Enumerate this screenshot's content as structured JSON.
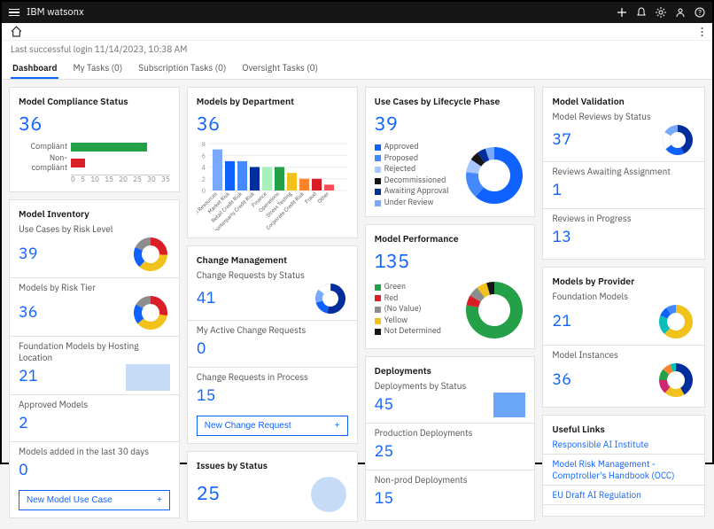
{
  "header": {
    "app_name": "IBM watsonx"
  },
  "last_login": "Last successful login 11/14/2023, 10:38 AM",
  "tabs": [
    {
      "label": "Dashboard",
      "active": true
    },
    {
      "label": "My Tasks (0)"
    },
    {
      "label": "Subscription Tasks (0)"
    },
    {
      "label": "Oversight Tasks (0)"
    }
  ],
  "compliance": {
    "title": "Model Compliance Status",
    "value": "36",
    "rows": [
      {
        "label": "Compliant",
        "value": 27,
        "color": "#24a148"
      },
      {
        "label": "Non-compliant",
        "value": 5,
        "color": "#da1e28"
      }
    ],
    "axis": [
      "0",
      "5",
      "10",
      "15",
      "20",
      "25",
      "30",
      "35"
    ]
  },
  "inventory": {
    "title": "Model Inventory",
    "items": [
      {
        "label": "Use Cases by Risk Level",
        "value": "39",
        "chart": "donut1"
      },
      {
        "label": "Models by Risk Tier",
        "value": "36",
        "chart": "donut2"
      },
      {
        "label": "Foundation Models by Hosting Location",
        "value": "21",
        "chart": "placeholder"
      },
      {
        "label": "Approved Models",
        "value": "2"
      },
      {
        "label": "Models added in the last 30 days",
        "value": "0"
      }
    ],
    "button": "New Model Use Case"
  },
  "dept": {
    "title": "Models by Department",
    "value": "36",
    "bars": [
      {
        "label": "Human Resources",
        "v": 7,
        "c": "#78a9ff"
      },
      {
        "label": "Market Risk",
        "v": 5,
        "c": "#0f62fe"
      },
      {
        "label": "Retail Credit Risk",
        "v": 5,
        "c": "#4589ff"
      },
      {
        "label": "Counterparty Credit Risk",
        "v": 4,
        "c": "#002d9c"
      },
      {
        "label": "Finance",
        "v": 4,
        "c": "#a7f0ba"
      },
      {
        "label": "Operations",
        "v": 4,
        "c": "#24a148"
      },
      {
        "label": "Stress Testing",
        "v": 3,
        "c": "#f1c21b"
      },
      {
        "label": "Corporate Credit Risk",
        "v": 2,
        "c": "#ff832b"
      },
      {
        "label": "Fraud",
        "v": 2,
        "c": "#da1e28"
      },
      {
        "label": "Other",
        "v": 1,
        "c": "#fa4d56"
      }
    ]
  },
  "change": {
    "title": "Change Management",
    "items": [
      {
        "label": "Change Requests by Status",
        "value": "41",
        "chart": "donut3"
      },
      {
        "label": "My Active Change Requests",
        "value": "0"
      },
      {
        "label": "Change Requests in Process",
        "value": "15"
      }
    ],
    "button": "New Change Request"
  },
  "issues": {
    "title": "Issues by Status",
    "value": "25"
  },
  "lifecycle": {
    "title": "Use Cases by Lifecycle Phase",
    "value": "39",
    "legend": [
      {
        "label": "Approved",
        "c": "#0f62fe"
      },
      {
        "label": "Proposed",
        "c": "#4589ff"
      },
      {
        "label": "Rejected",
        "c": "#a6c8ff"
      },
      {
        "label": "Decommissioned",
        "c": "#161616"
      },
      {
        "label": "Awaiting Approval",
        "c": "#002d9c"
      },
      {
        "label": "Under Review",
        "c": "#78a9ff"
      }
    ]
  },
  "perf": {
    "title": "Model Performance",
    "value": "135",
    "legend": [
      {
        "label": "Green",
        "c": "#24a148"
      },
      {
        "label": "Red",
        "c": "#da1e28"
      },
      {
        "label": "(No Value)",
        "c": "#8d8d8d"
      },
      {
        "label": "Yellow",
        "c": "#f1c21b"
      },
      {
        "label": "Not Determined",
        "c": "#161616"
      }
    ]
  },
  "deploy": {
    "title": "Deployments",
    "items": [
      {
        "label": "Deployments by Status",
        "value": "45",
        "chart": "bar"
      },
      {
        "label": "Production Deployments",
        "value": "25"
      },
      {
        "label": "Non-prod Deployments",
        "value": "15"
      }
    ]
  },
  "validation": {
    "title": "Model Validation",
    "items": [
      {
        "label": "Model Reviews by Status",
        "value": "37",
        "chart": "donut4"
      },
      {
        "label": "Reviews Awaiting Assignment",
        "value": "1"
      },
      {
        "label": "Reviews in Progress",
        "value": "13"
      }
    ]
  },
  "provider": {
    "title": "Models by Provider",
    "items": [
      {
        "label": "Foundation Models",
        "value": "21",
        "chart": "donut5"
      },
      {
        "label": "Model Instances",
        "value": "36",
        "chart": "donut6"
      }
    ]
  },
  "links": {
    "title": "Useful Links",
    "items": [
      "Responsible AI Institute",
      "Model Risk Management - Comptroller's Handbook (OCC)",
      "EU Draft AI Regulation"
    ]
  },
  "chart_data": [
    {
      "id": "compliance",
      "type": "bar",
      "orientation": "horizontal",
      "categories": [
        "Compliant",
        "Non-compliant"
      ],
      "values": [
        27,
        5
      ],
      "xlim": [
        0,
        35
      ]
    },
    {
      "id": "models_by_department",
      "type": "bar",
      "categories": [
        "Human Resources",
        "Market Risk",
        "Retail Credit Risk",
        "Counterparty Credit Risk",
        "Finance",
        "Operations",
        "Stress Testing",
        "Corporate Credit Risk",
        "Fraud",
        "Other"
      ],
      "values": [
        7,
        5,
        5,
        4,
        4,
        4,
        3,
        2,
        2,
        1
      ],
      "ylim": [
        0,
        8
      ]
    },
    {
      "id": "use_cases_by_risk_level",
      "type": "donut",
      "total": 39,
      "series": [
        {
          "name": "red",
          "value": 10,
          "color": "#da1e28"
        },
        {
          "name": "yellow",
          "value": 14,
          "color": "#f1c21b"
        },
        {
          "name": "blue",
          "value": 8,
          "color": "#0f62fe"
        },
        {
          "name": "grey",
          "value": 7,
          "color": "#8d8d8d"
        }
      ]
    },
    {
      "id": "models_by_risk_tier",
      "type": "donut",
      "total": 36,
      "series": [
        {
          "name": "red",
          "value": 10,
          "color": "#da1e28"
        },
        {
          "name": "yellow",
          "value": 13,
          "color": "#f1c21b"
        },
        {
          "name": "blue",
          "value": 7,
          "color": "#0f62fe"
        },
        {
          "name": "grey",
          "value": 6,
          "color": "#8d8d8d"
        }
      ]
    },
    {
      "id": "change_requests_by_status",
      "type": "donut",
      "total": 41,
      "series": [
        {
          "name": "navy",
          "value": 22,
          "color": "#002d9c"
        },
        {
          "name": "blue",
          "value": 7,
          "color": "#0f62fe"
        },
        {
          "name": "light",
          "value": 6,
          "color": "#78a9ff"
        },
        {
          "name": "white",
          "value": 6,
          "color": "#ffffff"
        }
      ]
    },
    {
      "id": "lifecycle_phase",
      "type": "donut",
      "total": 39,
      "series": [
        {
          "name": "Approved",
          "value": 24,
          "color": "#0f62fe"
        },
        {
          "name": "Proposed",
          "value": 6,
          "color": "#4589ff"
        },
        {
          "name": "Rejected",
          "value": 3,
          "color": "#a6c8ff"
        },
        {
          "name": "Decommissioned",
          "value": 2,
          "color": "#161616"
        },
        {
          "name": "Awaiting Approval",
          "value": 2,
          "color": "#002d9c"
        },
        {
          "name": "Under Review",
          "value": 2,
          "color": "#78a9ff"
        }
      ]
    },
    {
      "id": "model_performance",
      "type": "donut",
      "total": 135,
      "series": [
        {
          "name": "Green",
          "value": 105,
          "color": "#24a148"
        },
        {
          "name": "Red",
          "value": 8,
          "color": "#da1e28"
        },
        {
          "name": "(No Value)",
          "value": 8,
          "color": "#8d8d8d"
        },
        {
          "name": "Yellow",
          "value": 8,
          "color": "#f1c21b"
        },
        {
          "name": "Not Determined",
          "value": 6,
          "color": "#161616"
        }
      ]
    },
    {
      "id": "model_reviews_by_status",
      "type": "donut",
      "total": 37,
      "series": [
        {
          "name": "navy",
          "value": 16,
          "color": "#002d9c"
        },
        {
          "name": "blue",
          "value": 8,
          "color": "#0f62fe"
        },
        {
          "name": "white",
          "value": 7,
          "color": "#ffffff"
        },
        {
          "name": "light",
          "value": 6,
          "color": "#78a9ff"
        }
      ]
    },
    {
      "id": "foundation_models_by_provider",
      "type": "donut",
      "total": 21,
      "series": [
        {
          "name": "yellow",
          "value": 13,
          "color": "#f1c21b"
        },
        {
          "name": "teal",
          "value": 4,
          "color": "#08bdba"
        },
        {
          "name": "blue",
          "value": 2,
          "color": "#0f62fe"
        },
        {
          "name": "other",
          "value": 2,
          "color": "#4589ff"
        }
      ]
    },
    {
      "id": "model_instances_by_provider",
      "type": "donut",
      "total": 36,
      "series": [
        {
          "name": "navy",
          "value": 15,
          "color": "#002d9c"
        },
        {
          "name": "yellow",
          "value": 7,
          "color": "#f1c21b"
        },
        {
          "name": "magenta",
          "value": 5,
          "color": "#d02670"
        },
        {
          "name": "green",
          "value": 4,
          "color": "#24a148"
        },
        {
          "name": "orange",
          "value": 3,
          "color": "#ff832b"
        },
        {
          "name": "teal",
          "value": 2,
          "color": "#08bdba"
        }
      ]
    }
  ]
}
